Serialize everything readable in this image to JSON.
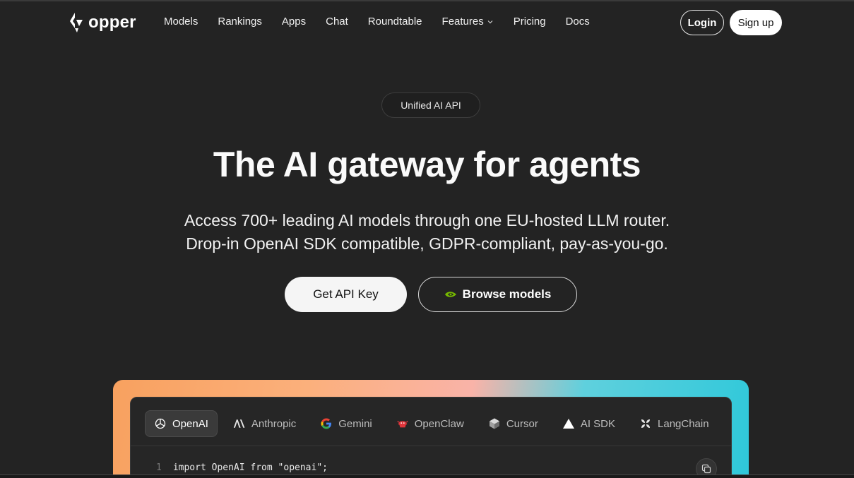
{
  "nav": {
    "logo_text": "opper",
    "links": [
      {
        "label": "Models"
      },
      {
        "label": "Rankings"
      },
      {
        "label": "Apps"
      },
      {
        "label": "Chat"
      },
      {
        "label": "Roundtable"
      },
      {
        "label": "Features",
        "has_dropdown": true
      },
      {
        "label": "Pricing"
      },
      {
        "label": "Docs"
      }
    ],
    "login_label": "Login",
    "signup_label": "Sign up"
  },
  "hero": {
    "badge": "Unified AI API",
    "title": "The AI gateway for agents",
    "subtitle_line1": "Access 700+ leading AI models through one EU-hosted LLM router.",
    "subtitle_line2": "Drop-in OpenAI SDK compatible, GDPR-compliant, pay-as-you-go.",
    "primary_cta": "Get API Key",
    "secondary_cta": "Browse models"
  },
  "code_panel": {
    "tabs": [
      {
        "label": "OpenAI",
        "icon": "openai-icon",
        "active": true
      },
      {
        "label": "Anthropic",
        "icon": "anthropic-icon",
        "active": false
      },
      {
        "label": "Gemini",
        "icon": "google-icon",
        "active": false
      },
      {
        "label": "OpenClaw",
        "icon": "openclaw-icon",
        "active": false
      },
      {
        "label": "Cursor",
        "icon": "cursor-icon",
        "active": false
      },
      {
        "label": "AI SDK",
        "icon": "triangle-icon",
        "active": false
      },
      {
        "label": "LangChain",
        "icon": "langchain-icon",
        "active": false
      }
    ],
    "code_lines": [
      {
        "number": "1",
        "text": "import OpenAI from \"openai\";"
      }
    ]
  },
  "colors": {
    "background": "#232323",
    "gradient_start": "#f8a15f",
    "gradient_end": "#2ec8da",
    "nvidia_green": "#76b900"
  }
}
